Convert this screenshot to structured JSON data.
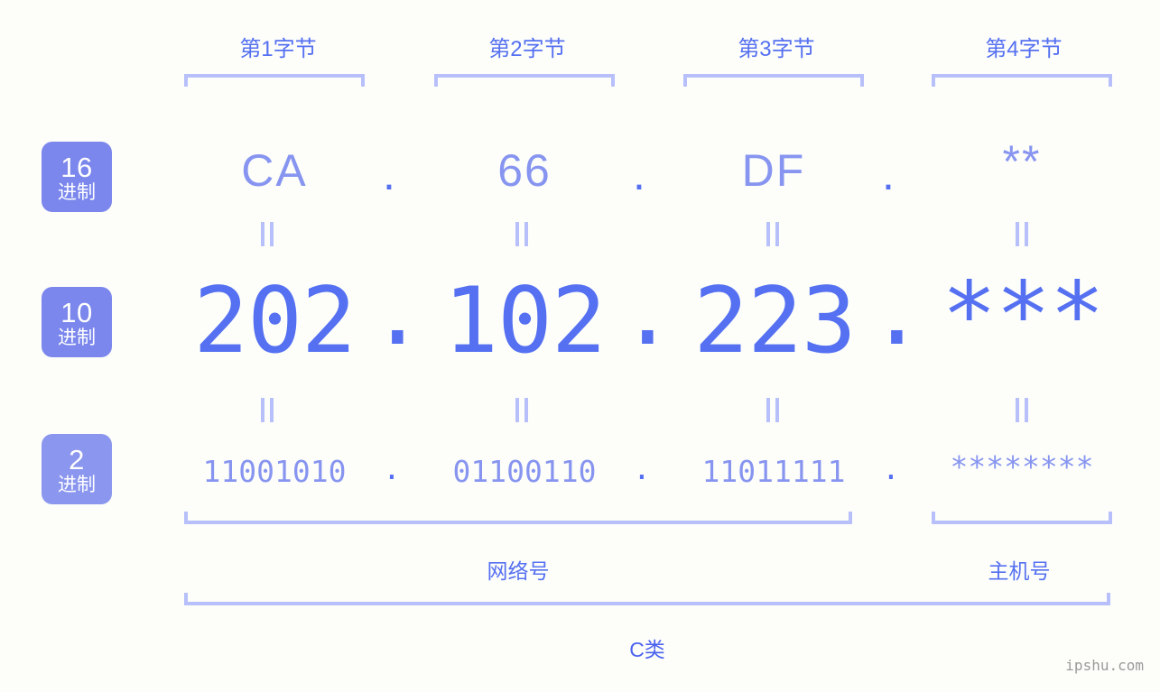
{
  "watermark": "ipshu.com",
  "byte_headers": [
    {
      "label": "第1字节"
    },
    {
      "label": "第2字节"
    },
    {
      "label": "第3字节"
    },
    {
      "label": "第4字节"
    }
  ],
  "bases": [
    {
      "num": "16",
      "system": "进制"
    },
    {
      "num": "10",
      "system": "进制"
    },
    {
      "num": "2",
      "system": "进制"
    }
  ],
  "rows": {
    "hex": {
      "octets": [
        "CA",
        "66",
        "DF",
        "**"
      ],
      "separator": "."
    },
    "decimal": {
      "octets": [
        "202",
        "102",
        "223",
        "***"
      ],
      "separator": "."
    },
    "binary": {
      "octets": [
        "11001010",
        "01100110",
        "11011111",
        "********"
      ],
      "separator": "."
    }
  },
  "equals_symbol": "=",
  "sections": [
    {
      "label": "网络号"
    },
    {
      "label": "主机号"
    }
  ],
  "ip_class": {
    "label": "C类"
  },
  "colors": {
    "background": "#fdfefa",
    "badge": "#7b87ec",
    "badge_light": "#8b96ee",
    "accent_strong": "#5570f1",
    "accent_mid": "#8795f0",
    "accent_light": "#b7c0fb",
    "watermark": "#9a9a9a"
  }
}
